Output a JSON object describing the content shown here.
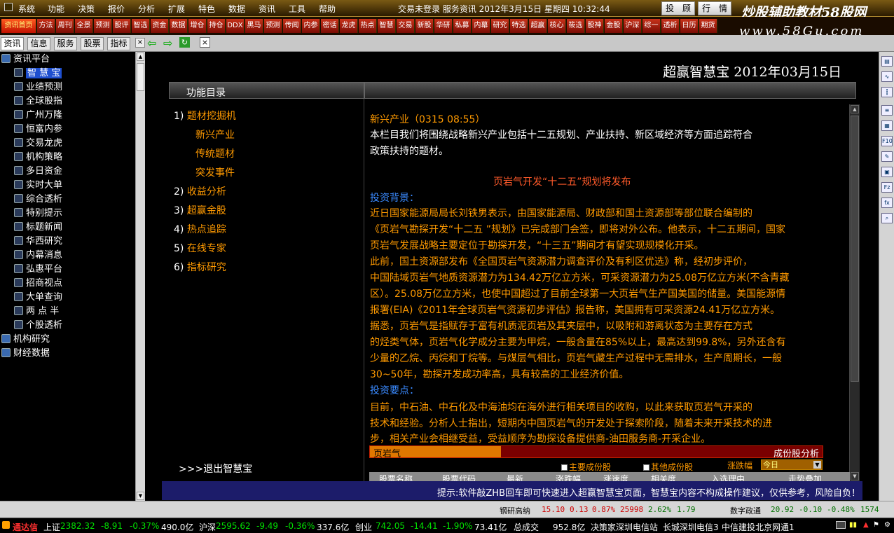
{
  "menu": {
    "items": [
      "系统",
      "功能",
      "决策",
      "报价",
      "分析",
      "扩展",
      "特色",
      "数据",
      "资讯",
      "工具",
      "帮助"
    ],
    "status": "交易未登录  服务资讯  2012年3月15日  星期四  10:32:44",
    "investor_button": "投　顾",
    "quote_button": "行　情"
  },
  "watermark": {
    "line1": "炒股辅助教材58股网",
    "line2": "www.58Gu.com"
  },
  "funcbar": [
    "资讯首页",
    "方法",
    "周刊",
    "全景",
    "预测",
    "股评",
    "智选",
    "资金",
    "数据",
    "增仓",
    "持仓",
    "DDX",
    "黑马",
    "预测",
    "传闻",
    "内参",
    "密话",
    "龙虎",
    "热点",
    "智慧",
    "交易",
    "新股",
    "华研",
    "私募",
    "内幕",
    "研究",
    "特选",
    "超赢",
    "核心",
    "筱选",
    "股神",
    "金股",
    "沪深",
    "综一",
    "透析",
    "日历",
    "期货"
  ],
  "tabs": [
    "资讯",
    "信息",
    "服务",
    "股票",
    "指标"
  ],
  "sidebar": {
    "items": [
      {
        "label": "资讯平台",
        "level": 0,
        "folder": true
      },
      {
        "label": "智 慧 宝",
        "level": 1,
        "selected": true
      },
      {
        "label": "业绩预测",
        "level": 1
      },
      {
        "label": "全球股指",
        "level": 1
      },
      {
        "label": "广州万隆",
        "level": 1
      },
      {
        "label": "恒富内参",
        "level": 1
      },
      {
        "label": "交易龙虎",
        "level": 1
      },
      {
        "label": "机构策略",
        "level": 1
      },
      {
        "label": "多日资金",
        "level": 1
      },
      {
        "label": "实时大单",
        "level": 1
      },
      {
        "label": "综合透析",
        "level": 1
      },
      {
        "label": "特别提示",
        "level": 1
      },
      {
        "label": "标题新闻",
        "level": 1
      },
      {
        "label": "华西研究",
        "level": 1
      },
      {
        "label": "内幕消息",
        "level": 1
      },
      {
        "label": "弘惠平台",
        "level": 1
      },
      {
        "label": "招商视点",
        "level": 1
      },
      {
        "label": "大单查询",
        "level": 1
      },
      {
        "label": "两 点 半",
        "level": 1
      },
      {
        "label": "个股透析",
        "level": 1
      },
      {
        "label": "机构研究",
        "level": 0,
        "folder": true
      },
      {
        "label": "财经数据",
        "level": 0,
        "folder": true
      }
    ]
  },
  "main": {
    "title": "超赢智慧宝 2012年03月15日",
    "toc_header": "功能目录",
    "toc": [
      {
        "num": "1)",
        "label": "题材挖掘机"
      },
      {
        "num": "",
        "label": "新兴产业"
      },
      {
        "num": "",
        "label": "传统题材"
      },
      {
        "num": "",
        "label": "突发事件"
      },
      {
        "num": "2)",
        "label": "收益分析"
      },
      {
        "num": "3)",
        "label": "超赢金股"
      },
      {
        "num": "4)",
        "label": "热点追踪"
      },
      {
        "num": "5)",
        "label": "在线专家"
      },
      {
        "num": "6)",
        "label": "指标研究"
      }
    ],
    "exit_link": ">>>退出智慧宝",
    "content_lines": [
      {
        "text": "新兴产业（0315  08:55）",
        "style": "orange"
      },
      {
        "text": "        本栏目我们将围绕战略新兴产业包括十二五规划、产业扶持、新区域经济等方面追踪符合",
        "style": "white"
      },
      {
        "text": "政策扶持的题材。",
        "style": "white"
      },
      {
        "text": "页岩气开发“十二五”规划将发布",
        "style": "red"
      },
      {
        "text": "投资背景：",
        "style": "blue"
      },
      {
        "text": "        近日国家能源局局长刘铁男表示，由国家能源局、财政部和国土资源部等部位联合编制的",
        "style": "orange"
      },
      {
        "text": "《页岩气勘探开发“十二五 ”规划》已完成部门会签，即将对外公布。他表示，十二五期间，国家",
        "style": "orange"
      },
      {
        "text": "页岩气发展战略主要定位于勘探开发，“十三五”期间才有望实现规模化开采。",
        "style": "orange"
      },
      {
        "text": "        此前，国土资源部发布《全国页岩气资源潜力调查评价及有利区优选》称，经初步评价，",
        "style": "orange"
      },
      {
        "text": "中国陆域页岩气地质资源潜力为134.42万亿立方米，可采资源潜力为25.08万亿立方米(不含青藏",
        "style": "orange"
      },
      {
        "text": "区）。25.08万亿立方米，也使中国超过了目前全球第一大页岩气生产国美国的储量。美国能源情",
        "style": "orange"
      },
      {
        "text": "报署(EIA)《2011年全球页岩气资源初步评估》报告称，美国拥有可采资源24.41万亿立方米。",
        "style": "orange"
      },
      {
        "text": "        据悉，页岩气是指赋存于富有机质泥页岩及其夹层中，以吸附和游离状态为主要存在方式",
        "style": "orange"
      },
      {
        "text": "的烃类气体，页岩气化学成分主要为甲烷，一般含量在85%以上，最高达到99.8%，另外还含有",
        "style": "orange"
      },
      {
        "text": "少量的乙烷、丙烷和丁烷等。与煤层气相比，页岩气藏生产过程中无需排水，生产周期长，一般",
        "style": "orange"
      },
      {
        "text": "30~50年，勘探开发成功率高，具有较高的工业经济价值。",
        "style": "orange"
      },
      {
        "text": "投资要点：",
        "style": "blue"
      },
      {
        "text": "        目前，中石油、中石化及中海油均在海外进行相关项目的收购，以此来获取页岩气开采的",
        "style": "orange"
      },
      {
        "text": "技术和经验。分析人士指出，短期内中国页岩气的开发处于探索阶段，随着未来开采技术的进",
        "style": "orange"
      },
      {
        "text": "步，相关产业会相继受益，受益顺序为勘探设备提供商-油田服务商-开采企业。",
        "style": "orange"
      }
    ],
    "stock_bar": {
      "label": "页岩气",
      "right_label": "成份股分析",
      "fill_fraction": 0.29
    },
    "checkboxes": [
      "主要成份股",
      "其他成份股"
    ],
    "change_label": "涨跌幅",
    "change_select": "今日",
    "table_headers": [
      "股票名称",
      "股票代码",
      "最新",
      "涨跌幅",
      "涨速度",
      "相关度",
      "入选理由",
      "走势叠加"
    ],
    "tip": "提示:软件敲ZHB回车即可快速进入超赢智慧宝页面，智慧宝内容不构成操作建议，仅供参考，风险自负！"
  },
  "ticker1": {
    "name1": "钢研高纳",
    "price1": "15.10",
    "chg1": "0.13",
    "pct1": "0.87%",
    "vol1": "25998",
    "r1": "2.62%",
    "v1": "1.79",
    "name2": "数字政通",
    "price2": "20.92",
    "chg2": "-0.10",
    "pct2": "-0.48%",
    "vol2": "1574"
  },
  "ticker2": {
    "brand": "通达信",
    "sh_label": "上证",
    "sh_price": "2382.32",
    "sh_chg": "-8.91",
    "sh_pct": "-0.37%",
    "sh_amt": "490.0亿",
    "sz_label": "沪深",
    "sz_price": "2595.62",
    "sz_chg": "-9.49",
    "sz_pct": "-0.36%",
    "sz_amt": "337.6亿",
    "cy_label": "创业",
    "cy_price": "742.05",
    "cy_chg": "-14.41",
    "cy_pct": "-1.90%",
    "cy_amt": "73.41亿",
    "total_label": "总成交",
    "total_amt": "952.8亿",
    "server1": "决策家深圳电信站",
    "server2": "长城深圳电信3",
    "server3": "中信建投北京网通1"
  }
}
